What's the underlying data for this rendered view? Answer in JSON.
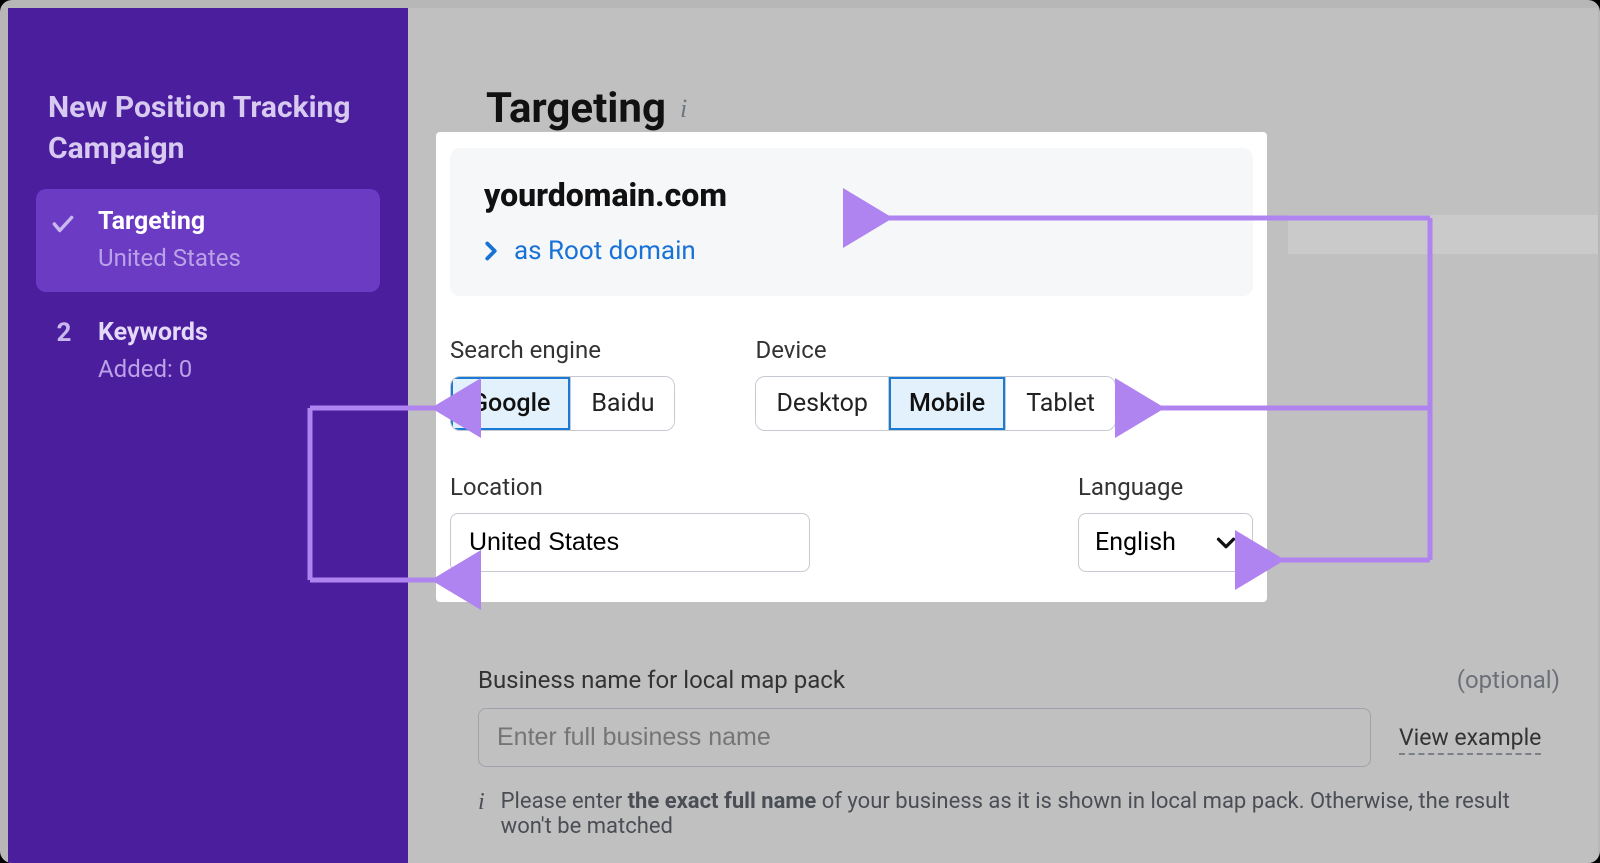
{
  "sidebar": {
    "title_line1": "New Position Tracking",
    "title_line2": "Campaign",
    "steps": [
      {
        "label": "Targeting",
        "sub": "United States"
      },
      {
        "label": "Keywords",
        "sub": "Added: 0",
        "index": "2"
      }
    ]
  },
  "heading": "Targeting",
  "domain": {
    "name": "yourdomain.com",
    "as_label": "as Root domain"
  },
  "search_engine": {
    "label": "Search engine",
    "options": [
      "Google",
      "Baidu"
    ],
    "selected": "Google"
  },
  "device": {
    "label": "Device",
    "options": [
      "Desktop",
      "Mobile",
      "Tablet"
    ],
    "selected": "Mobile"
  },
  "location": {
    "label": "Location",
    "value": "United States"
  },
  "language": {
    "label": "Language",
    "value": "English"
  },
  "business": {
    "label": "Business name for local map pack",
    "optional": "(optional)",
    "placeholder": "Enter full business name",
    "view_example": "View example",
    "tip_pre": "Please enter ",
    "tip_bold": "the exact full name",
    "tip_post": " of your business as it is shown in local map pack. Otherwise, the result won't be matched"
  }
}
